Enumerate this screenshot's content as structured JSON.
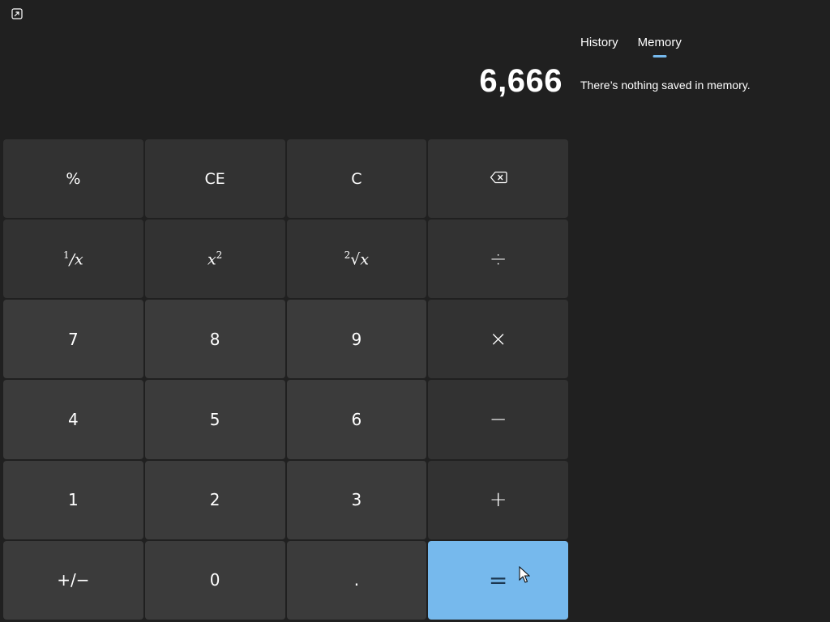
{
  "display": {
    "value": "6,666"
  },
  "tabs": [
    {
      "label": "History",
      "active": false
    },
    {
      "label": "Memory",
      "active": true
    }
  ],
  "memory": {
    "empty_message": "There’s nothing saved in memory."
  },
  "keys": {
    "percent": "%",
    "ce": "CE",
    "c": "C",
    "n7": "7",
    "n8": "8",
    "n9": "9",
    "n4": "4",
    "n5": "5",
    "n6": "6",
    "n1": "1",
    "n2": "2",
    "n3": "3",
    "n0": "0",
    "decimal": ".",
    "negate": "+/−",
    "divide": "÷",
    "multiply": "×",
    "subtract": "−",
    "add": "+",
    "equals": "="
  },
  "icons": {
    "keep_on_top": "keep-on-top-icon",
    "backspace": "backspace-icon"
  },
  "colors": {
    "background": "#202020",
    "function_key": "#323232",
    "number_key": "#3b3b3b",
    "accent": "#76b9ed"
  }
}
